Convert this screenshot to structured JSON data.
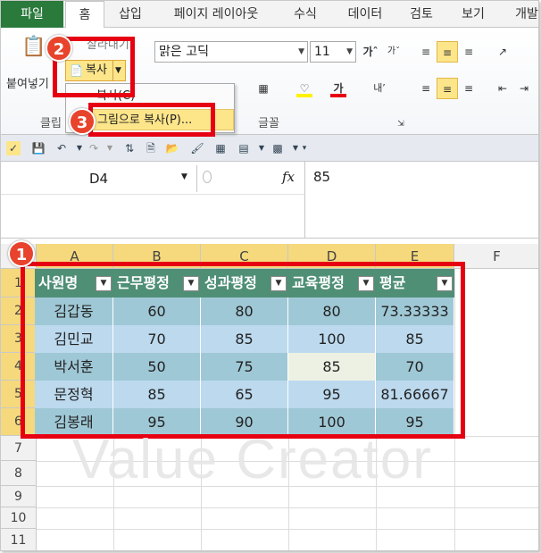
{
  "tabs": [
    "파일",
    "홈",
    "삽입",
    "페이지 레이아웃",
    "수식",
    "데이터",
    "검토",
    "보기",
    "개발"
  ],
  "ribbon": {
    "paste_label": "붙여넣기",
    "cut_label": "잘라내기",
    "copy_label": "복사",
    "copy_sub_label": "복사(C)",
    "copy_as_picture_label": "그림으로 복사(P)...",
    "clipboard_group_label": "클립",
    "font_group_label": "글꼴",
    "font_name": "맑은 고딕",
    "font_size": "11",
    "wrap_label": "내 ",
    "fill_color": "#fff200",
    "font_color": "#e60012"
  },
  "badges": [
    "1",
    "2",
    "3"
  ],
  "formula_bar": {
    "name_box": "D4",
    "fx_label": "fx",
    "value": "85"
  },
  "columns": [
    "A",
    "B",
    "C",
    "D",
    "E",
    "F"
  ],
  "rows": [
    "1",
    "2",
    "3",
    "4",
    "5",
    "6",
    "7",
    "8",
    "9",
    "10",
    "11"
  ],
  "table": {
    "headers": [
      "사원명",
      "근무평정",
      "성과평정",
      "교육평정",
      "평균"
    ],
    "rows": [
      [
        "김갑동",
        "60",
        "80",
        "80",
        "73.33333"
      ],
      [
        "김민교",
        "70",
        "85",
        "100",
        "85"
      ],
      [
        "박서훈",
        "50",
        "75",
        "85",
        "70"
      ],
      [
        "문정혁",
        "85",
        "65",
        "95",
        "81.66667"
      ],
      [
        "김봉래",
        "95",
        "90",
        "100",
        "95"
      ]
    ]
  },
  "watermark": "Value Creator",
  "colors": {
    "header_green": "#4f8f76",
    "row_dark": "#9fc8d6",
    "row_light": "#bcd9ee",
    "selected_cell": "#edf1e3",
    "highlight_red": "#e60012"
  }
}
